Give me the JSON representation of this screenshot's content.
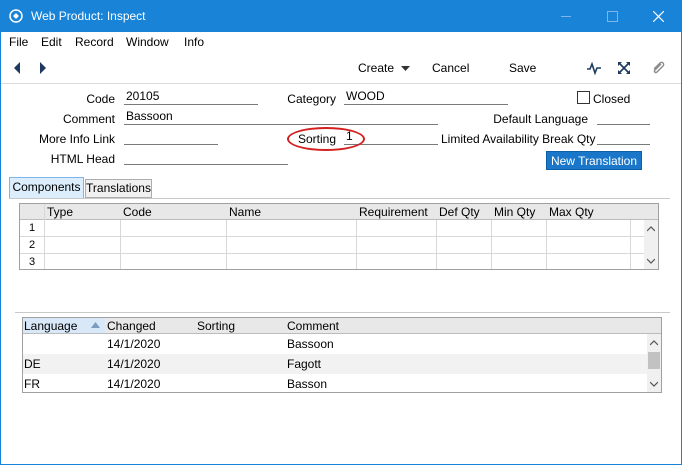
{
  "window": {
    "title": "Web Product: Inspect"
  },
  "menu": [
    "File",
    "Edit",
    "Record",
    "Window",
    "Info"
  ],
  "toolbar": {
    "create_label": "Create",
    "cancel_label": "Cancel",
    "save_label": "Save"
  },
  "form": {
    "code_label": "Code",
    "code_value": "20105",
    "category_label": "Category",
    "category_value": "WOOD",
    "closed_label": "Closed",
    "comment_label": "Comment",
    "comment_value": "Bassoon",
    "default_language_label": "Default Language",
    "default_language_value": "",
    "more_info_link_label": "More Info Link",
    "more_info_link_value": "",
    "sorting_label": "Sorting",
    "sorting_value": "1",
    "limited_availability_label": "Limited Availability Break Qty",
    "limited_availability_value": "",
    "html_head_label": "HTML Head",
    "html_head_value": "",
    "new_translation_label": "New Translation"
  },
  "tabs": [
    {
      "label": "Components",
      "active": true
    },
    {
      "label": "Translations",
      "active": false
    }
  ],
  "components": {
    "columns": [
      "Type",
      "Code",
      "Name",
      "Requirement",
      "Def Qty",
      "Min Qty",
      "Max Qty"
    ],
    "rows": [
      "1",
      "2",
      "3"
    ]
  },
  "translations": {
    "columns": [
      "Language",
      "Changed",
      "Sorting",
      "Comment"
    ],
    "rows": [
      {
        "language": "",
        "changed": "14/1/2020",
        "sorting": "",
        "comment": "Bassoon"
      },
      {
        "language": "DE",
        "changed": "14/1/2020",
        "sorting": "",
        "comment": "Fagott"
      },
      {
        "language": "FR",
        "changed": "14/1/2020",
        "sorting": "",
        "comment": "Basson"
      }
    ]
  }
}
